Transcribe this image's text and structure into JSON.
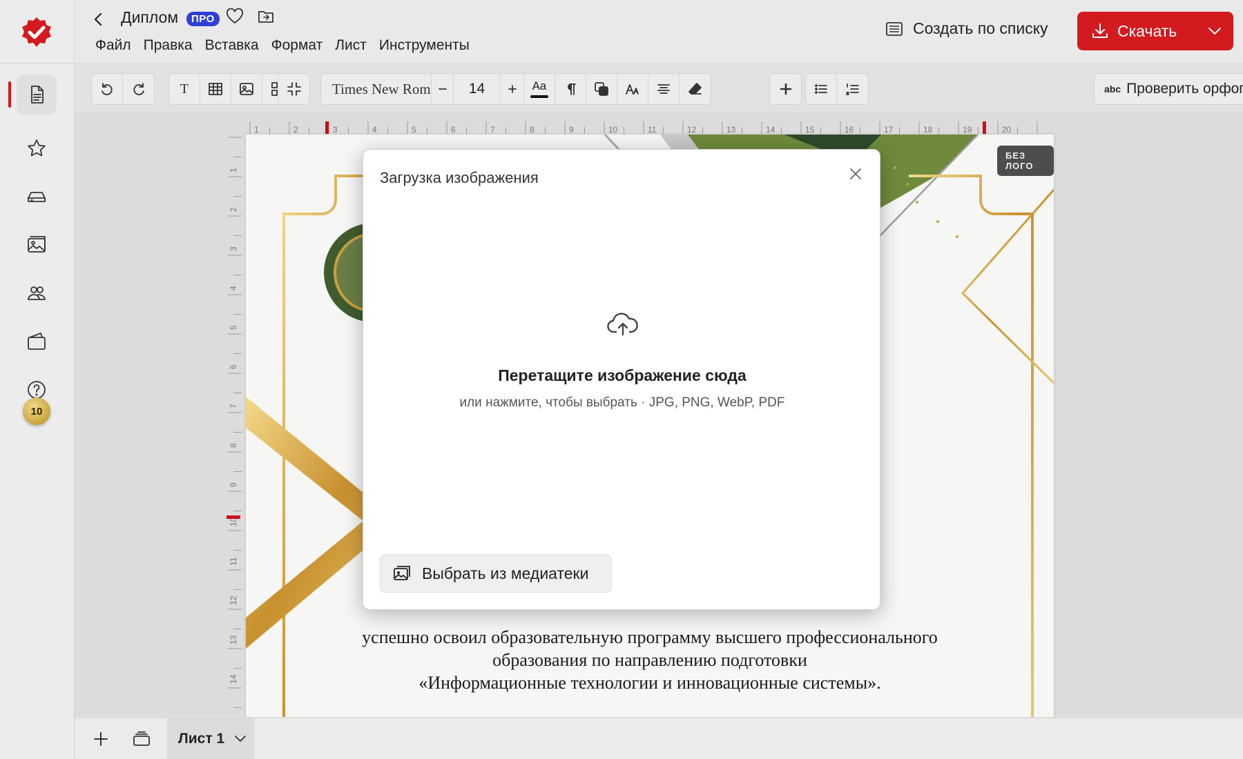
{
  "app": {
    "accent_color": "#d31a1e",
    "pro_color": "#2f3fd8"
  },
  "header": {
    "doc_title": "Диплом",
    "pro_badge": "ПРО",
    "menu": [
      "Файл",
      "Правка",
      "Вставка",
      "Формат",
      "Лист",
      "Инструменты"
    ],
    "create_by_list": "Создать по списку",
    "download": "Скачать"
  },
  "sidebar": {
    "items": [
      {
        "name": "document-icon",
        "active": true
      },
      {
        "name": "star-icon",
        "active": false
      },
      {
        "name": "drive-icon",
        "active": false
      },
      {
        "name": "gallery-icon",
        "active": false
      },
      {
        "name": "users-icon",
        "active": false
      },
      {
        "name": "wallet-icon",
        "active": false
      },
      {
        "name": "help-icon",
        "active": false
      }
    ],
    "coins": "10"
  },
  "toolbar": {
    "font_name": "Times New Roman",
    "font_size": "14",
    "text_tool": "T",
    "font_case": "Aa",
    "spellcheck": "Проверить орфографию",
    "spell_abbr": "abc"
  },
  "ruler": {
    "h_labels": [
      "1",
      "2",
      "3",
      "4",
      "5",
      "6",
      "7",
      "8",
      "9",
      "10",
      "11",
      "12",
      "13",
      "14",
      "15",
      "16",
      "17",
      "18",
      "19",
      "20"
    ],
    "v_labels": [
      "1",
      "2",
      "3",
      "4",
      "5",
      "6",
      "7",
      "8",
      "9",
      "10",
      "11",
      "12",
      "13",
      "14"
    ]
  },
  "sheet": {
    "no_logo": "БЕЗ ЛОГО",
    "body_lines": [
      "успешно освоил образовательную программу высшего профессионального",
      "образования по направлению подготовки",
      "«Информационные технологии и инновационные системы»."
    ]
  },
  "dialog": {
    "title": "Загрузка изображения",
    "drop_title": "Перетащите изображение сюда",
    "drop_sub": "или нажмите, чтобы выбрать · JPG, PNG, WebP, PDF",
    "media_button": "Выбрать из медиатеки"
  },
  "bottom": {
    "sheet_tab": "Лист 1"
  }
}
